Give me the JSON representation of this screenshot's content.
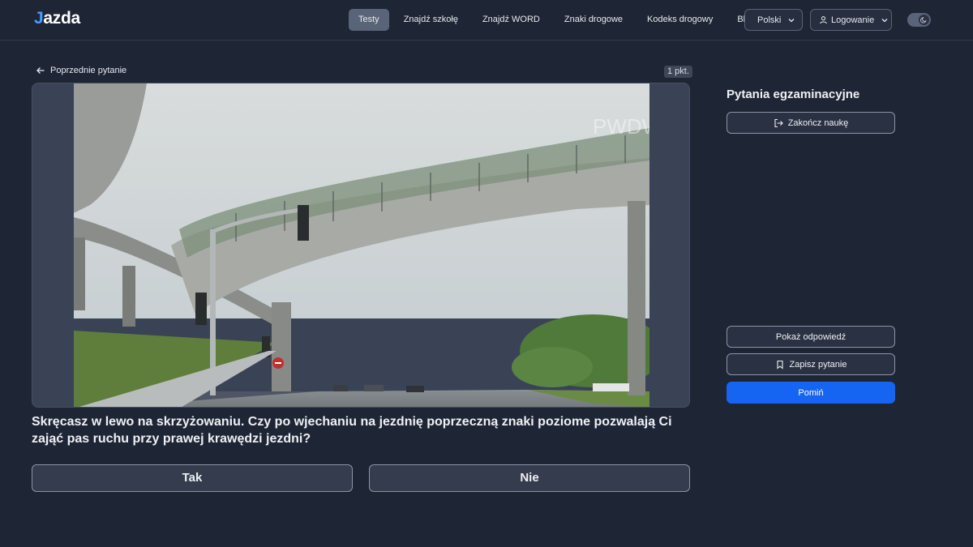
{
  "header": {
    "logo_j": "J",
    "logo_rest": "azda",
    "nav": [
      {
        "label": "Testy",
        "active": true
      },
      {
        "label": "Znajdź szkołę",
        "active": false
      },
      {
        "label": "Znajdź WORD",
        "active": false
      },
      {
        "label": "Znaki drogowe",
        "active": false
      },
      {
        "label": "Kodeks drogowy",
        "active": false
      },
      {
        "label": "Blog",
        "active": false
      }
    ],
    "language": "Polski",
    "login": "Logowanie",
    "theme_toggle_icon": "moon-icon"
  },
  "question_panel": {
    "back_label": "Poprzednie pytanie",
    "points_badge": "1 pkt.",
    "question_text": "Skręcasz w lewo na skrzyżowaniu. Czy po wjechaniu na jezdnię poprzeczną znaki poziome pozwalają Ci zająć pas ruchu przy prawej krawędzi jezdni?",
    "answers": [
      {
        "label": "Tak"
      },
      {
        "label": "Nie"
      }
    ]
  },
  "sidebar": {
    "title": "Pytania egzaminacyjne",
    "finish_label": "Zakończ naukę",
    "show_answer_label": "Pokaż odpowiedź",
    "save_question_label": "Zapisz pytanie",
    "skip_label": "Pomiń"
  },
  "colors": {
    "background": "#1e2535",
    "accent": "#1565f2",
    "logo_accent": "#4a9cff"
  }
}
